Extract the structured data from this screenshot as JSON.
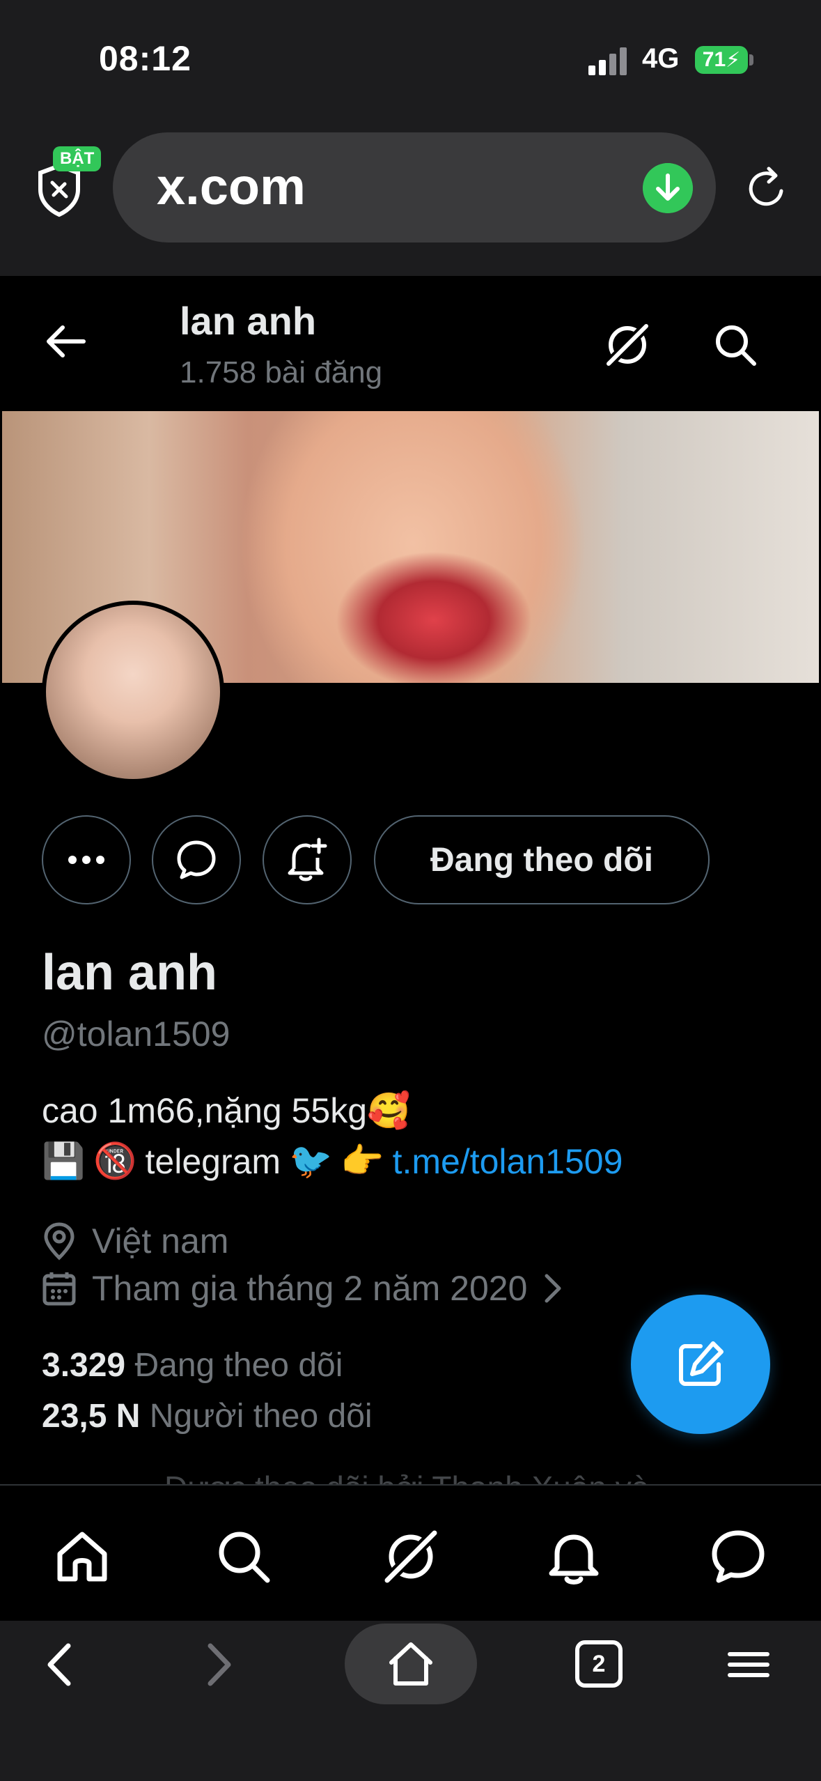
{
  "status_bar": {
    "time": "08:12",
    "network": "4G",
    "battery": "71"
  },
  "browser": {
    "shield_badge": "BẬT",
    "url": "x.com"
  },
  "header": {
    "title": "lan anh",
    "post_count": "1.758 bài đăng"
  },
  "profile": {
    "name": "lan anh",
    "handle": "@tolan1509",
    "bio_line1": "cao 1m66,nặng 55kg",
    "bio_emoji1": "🥰",
    "bio_emojis2": [
      "💾",
      "🔞"
    ],
    "bio_telegram": "telegram",
    "bio_emojis3": [
      "🐦",
      "👉"
    ],
    "bio_link": "t.me/tolan1509",
    "location": "Việt  nam",
    "joined": "Tham gia tháng 2 năm 2020",
    "following_count": "3.329",
    "following_label": "Đang theo dõi",
    "followers_count": "23,5 N",
    "followers_label": "Người theo dõi",
    "followed_by_partial": "Được theo dõi bởi Thanh Xuân và"
  },
  "actions": {
    "follow_label": "Đang theo dõi"
  },
  "tab_counter": "2",
  "colors": {
    "accent": "#1d9bf0",
    "green": "#32c759",
    "muted": "#71767b"
  }
}
